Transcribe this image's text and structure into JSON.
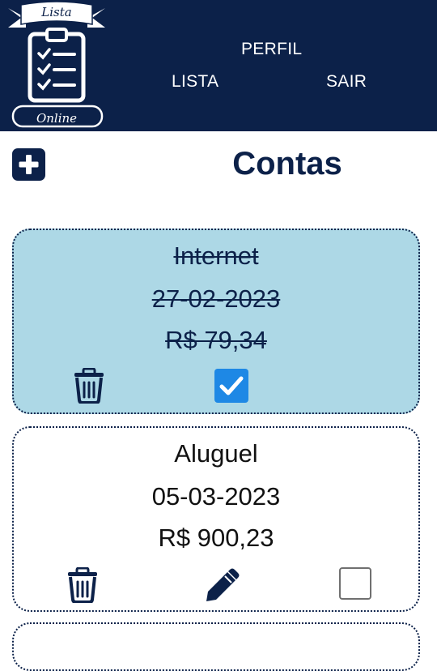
{
  "logo": {
    "top_text": "Lista",
    "bottom_text": "Online"
  },
  "nav": {
    "perfil": "PERFIL",
    "lista": "LISTA",
    "sair": "SAIR"
  },
  "page": {
    "title": "Contas",
    "add_icon": "plus-icon"
  },
  "colors": {
    "navy": "#0c2149",
    "paid_card": "#add8e6",
    "checkbox_checked": "#1e88e5"
  },
  "accounts": [
    {
      "name": "Internet",
      "date": "27-02-2023",
      "amount": "R$ 79,34",
      "paid": true,
      "actions": [
        "trash-icon",
        "checkbox-checked"
      ]
    },
    {
      "name": "Aluguel",
      "date": "05-03-2023",
      "amount": "R$ 900,23",
      "paid": false,
      "actions": [
        "trash-icon",
        "pencil-icon",
        "checkbox-empty"
      ]
    }
  ]
}
